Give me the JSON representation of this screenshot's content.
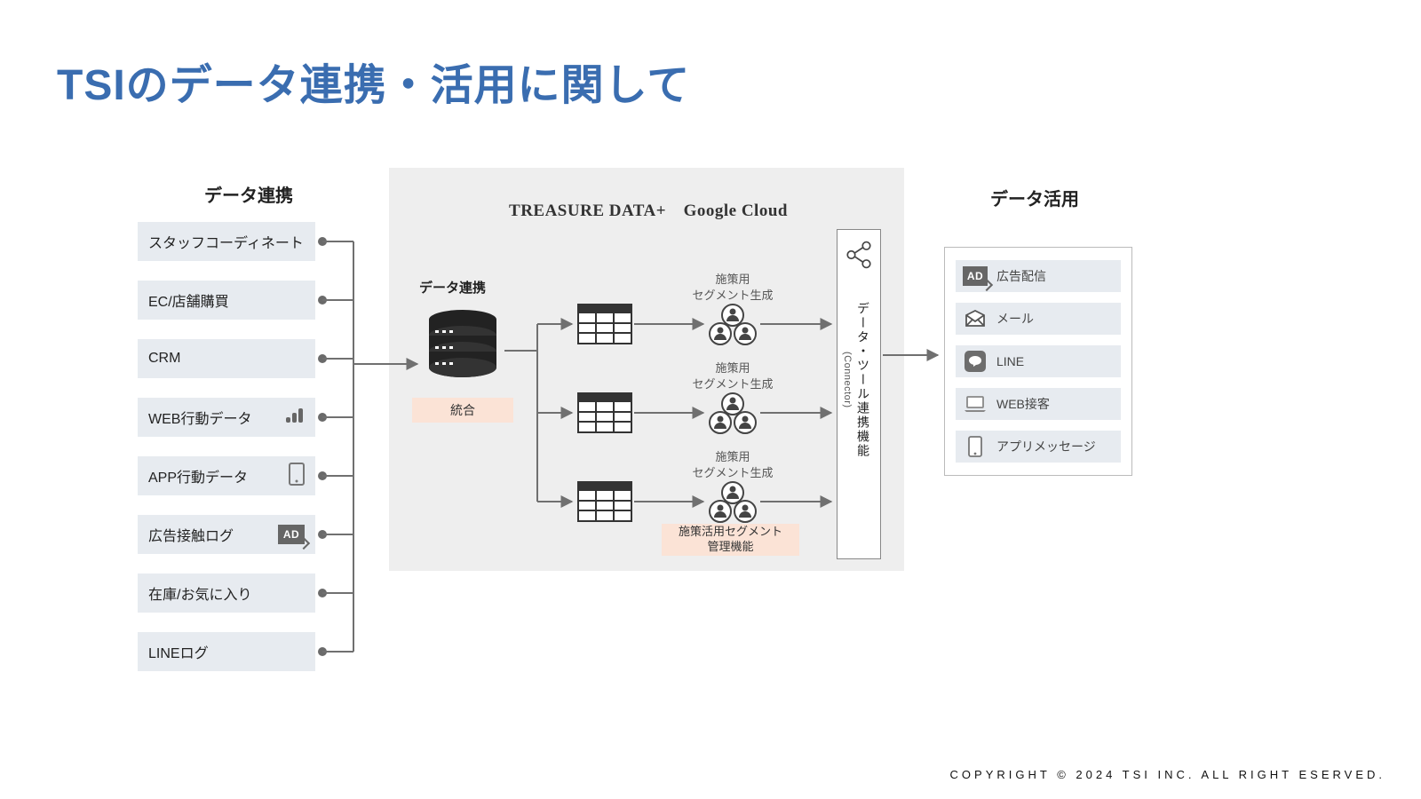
{
  "title": "TSIのデータ連携・活用に関して",
  "copyright": "COPYRIGHT © 2024 TSI INC. ALL RIGHT ESERVED.",
  "sources_header": "データ連携",
  "sources": [
    "スタッフコーディネート",
    "EC/店舗購買",
    "CRM",
    "WEB行動データ",
    "APP行動データ",
    "広告接触ログ",
    "在庫/お気に入り",
    "LINEログ"
  ],
  "middle": {
    "platform": "TREASURE DATA+　Google Cloud",
    "sub_header": "データ連携",
    "integration_label": "統合",
    "segment_label_line1": "施策用",
    "segment_label_line2": "セグメント生成",
    "mgmt_label": "施策活用セグメント\n管理機能",
    "connector_label": "データ・ツール連携機能",
    "connector_sub": "(Connector)"
  },
  "uses_header": "データ活用",
  "uses": [
    "広告配信",
    "メール",
    "LINE",
    "WEB接客",
    "アプリメッセージ"
  ]
}
